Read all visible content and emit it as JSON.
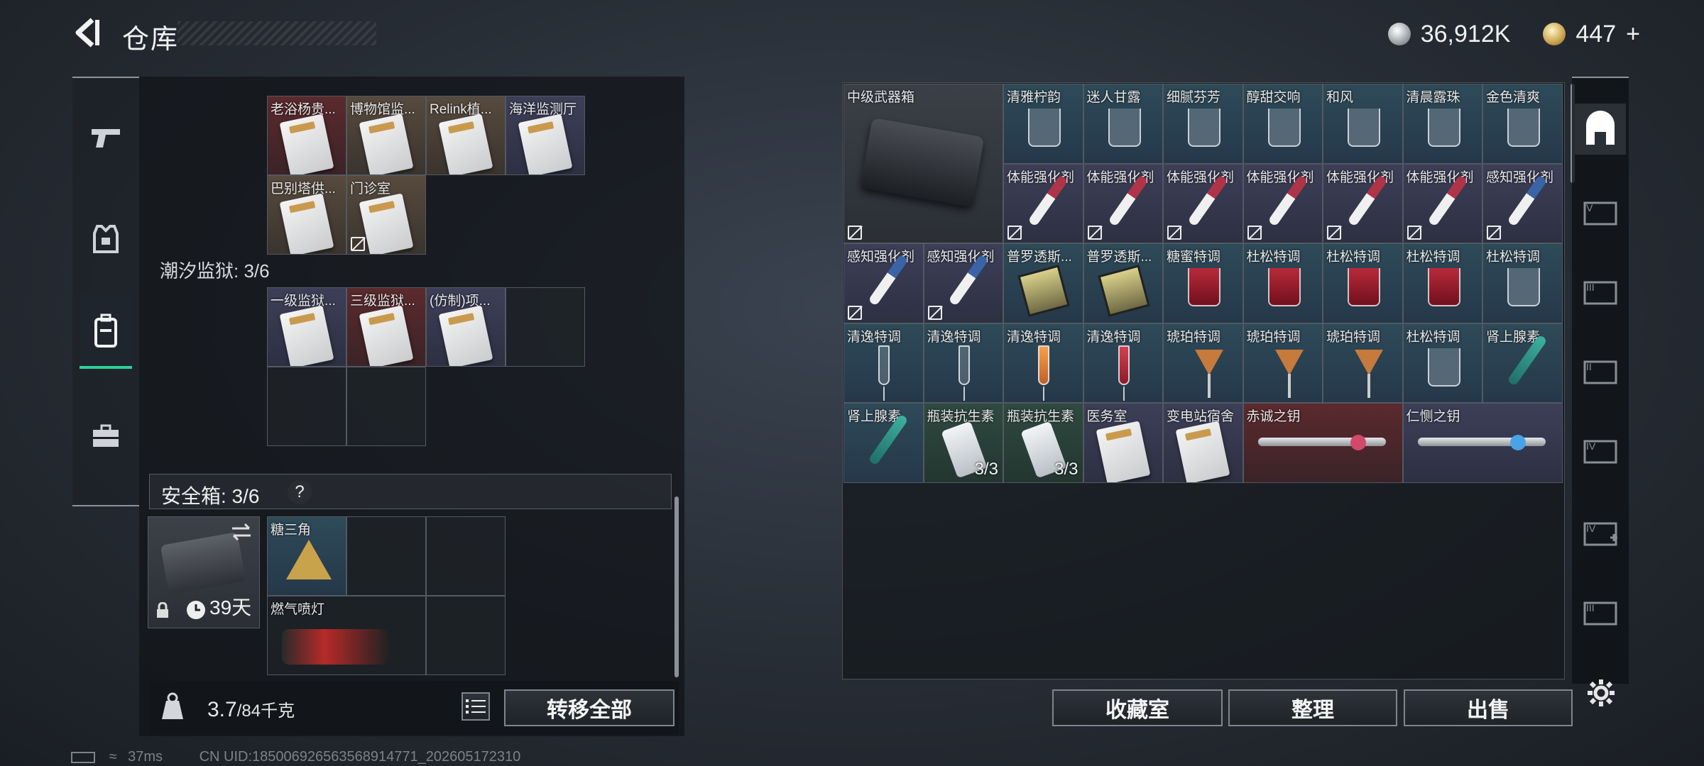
{
  "header": {
    "title": "仓库",
    "silver_amount": "36,912K",
    "gold_amount": "447",
    "gold_plus": "+"
  },
  "left": {
    "collection_items": [
      {
        "label": "老浴杨贵...",
        "tone": "red"
      },
      {
        "label": "博物馆监...",
        "tone": "brown"
      },
      {
        "label": "Relink植...",
        "tone": "brown"
      },
      {
        "label": "海洋监测厅",
        "tone": "purple"
      },
      {
        "label": "巴别塔供...",
        "tone": "brown"
      },
      {
        "label": "门诊室",
        "tone": "brown"
      }
    ],
    "section_title": "潮汐监狱: 3/6",
    "tide_items": [
      {
        "label": "一级监狱...",
        "tone": "purple"
      },
      {
        "label": "三级监狱...",
        "tone": "red"
      },
      {
        "label": "(仿制)项...",
        "tone": "purple"
      }
    ],
    "safebox_label": "安全箱: 3/6",
    "safebox_help": "?",
    "safebox_days": "39天",
    "safe_items": [
      {
        "label": "糖三角"
      },
      {
        "label": "燃气喷灯"
      }
    ],
    "weight_current": "3.7",
    "weight_total": "/84千克",
    "transfer_all_label": "转移全部"
  },
  "right": {
    "weapon_box_label": "中级武器箱",
    "items": [
      {
        "label": "清雅柠韵",
        "kind": "glass"
      },
      {
        "label": "迷人甘露",
        "kind": "glass"
      },
      {
        "label": "细腻芬芳",
        "kind": "glass"
      },
      {
        "label": "醇甜交响",
        "kind": "glass"
      },
      {
        "label": "和风",
        "kind": "glass"
      },
      {
        "label": "清晨露珠",
        "kind": "glass"
      },
      {
        "label": "金色清爽",
        "kind": "glass"
      },
      {
        "label": "体能强化剂",
        "kind": "syringe-red"
      },
      {
        "label": "体能强化剂",
        "kind": "syringe-red"
      },
      {
        "label": "体能强化剂",
        "kind": "syringe-red"
      },
      {
        "label": "体能强化剂",
        "kind": "syringe-red"
      },
      {
        "label": "体能强化剂",
        "kind": "syringe-red"
      },
      {
        "label": "体能强化剂",
        "kind": "syringe-red"
      },
      {
        "label": "感知强化剂",
        "kind": "syringe-blue"
      },
      {
        "label": "感知强化剂",
        "kind": "syringe-blue"
      },
      {
        "label": "感知强化剂",
        "kind": "syringe-blue"
      },
      {
        "label": "普罗透斯...",
        "kind": "device"
      },
      {
        "label": "普罗透斯...",
        "kind": "device"
      },
      {
        "label": "糖蜜特调",
        "kind": "glass-red"
      },
      {
        "label": "杜松特调",
        "kind": "glass-red"
      },
      {
        "label": "杜松特调",
        "kind": "glass-red"
      },
      {
        "label": "杜松特调",
        "kind": "glass-red"
      },
      {
        "label": "杜松特调",
        "kind": "glass"
      },
      {
        "label": "清逸特调",
        "kind": "flute"
      },
      {
        "label": "清逸特调",
        "kind": "flute"
      },
      {
        "label": "清逸特调",
        "kind": "flute-orange"
      },
      {
        "label": "清逸特调",
        "kind": "flute-red"
      },
      {
        "label": "琥珀特调",
        "kind": "cocktail"
      },
      {
        "label": "琥珀特调",
        "kind": "cocktail"
      },
      {
        "label": "琥珀特调",
        "kind": "cocktail"
      },
      {
        "label": "杜松特调",
        "kind": "glass"
      },
      {
        "label": "肾上腺素",
        "kind": "syringe-teal"
      },
      {
        "label": "肾上腺素",
        "kind": "syringe-teal"
      },
      {
        "label": "瓶装抗生素",
        "kind": "bottle",
        "stack": "3/3"
      },
      {
        "label": "瓶装抗生素",
        "kind": "bottle",
        "stack": "3/3"
      },
      {
        "label": "医务室",
        "kind": "card"
      },
      {
        "label": "变电站宿舍",
        "kind": "card"
      },
      {
        "label": "赤诚之钥",
        "kind": "key-red"
      },
      {
        "label": "仁恻之钥",
        "kind": "key-blue"
      }
    ],
    "collection_room_label": "收藏室",
    "organize_label": "整理",
    "sell_label": "出售"
  },
  "status": {
    "ping": "37ms",
    "uid": "CN UID:185006926563568914771_202605172310"
  }
}
